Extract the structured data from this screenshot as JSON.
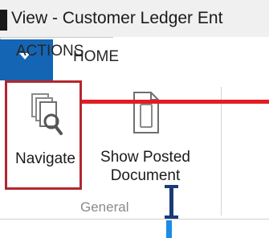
{
  "window": {
    "title": "View - Customer Ledger Ent"
  },
  "ribbon": {
    "tabs": [
      {
        "label": "HOME",
        "selected": false
      },
      {
        "label": "ACTIONS",
        "selected": true
      }
    ],
    "groups": [
      {
        "label": "General",
        "buttons": [
          {
            "label": "Navigate",
            "icon": "navigate-icon",
            "highlighted": true
          },
          {
            "label": "Show Posted Document",
            "icon": "document-icon",
            "highlighted": false
          }
        ]
      }
    ]
  },
  "colors": {
    "app_menu": "#1565b5",
    "highlight_border": "#b3272d",
    "pointer_line": "#e31b23"
  }
}
